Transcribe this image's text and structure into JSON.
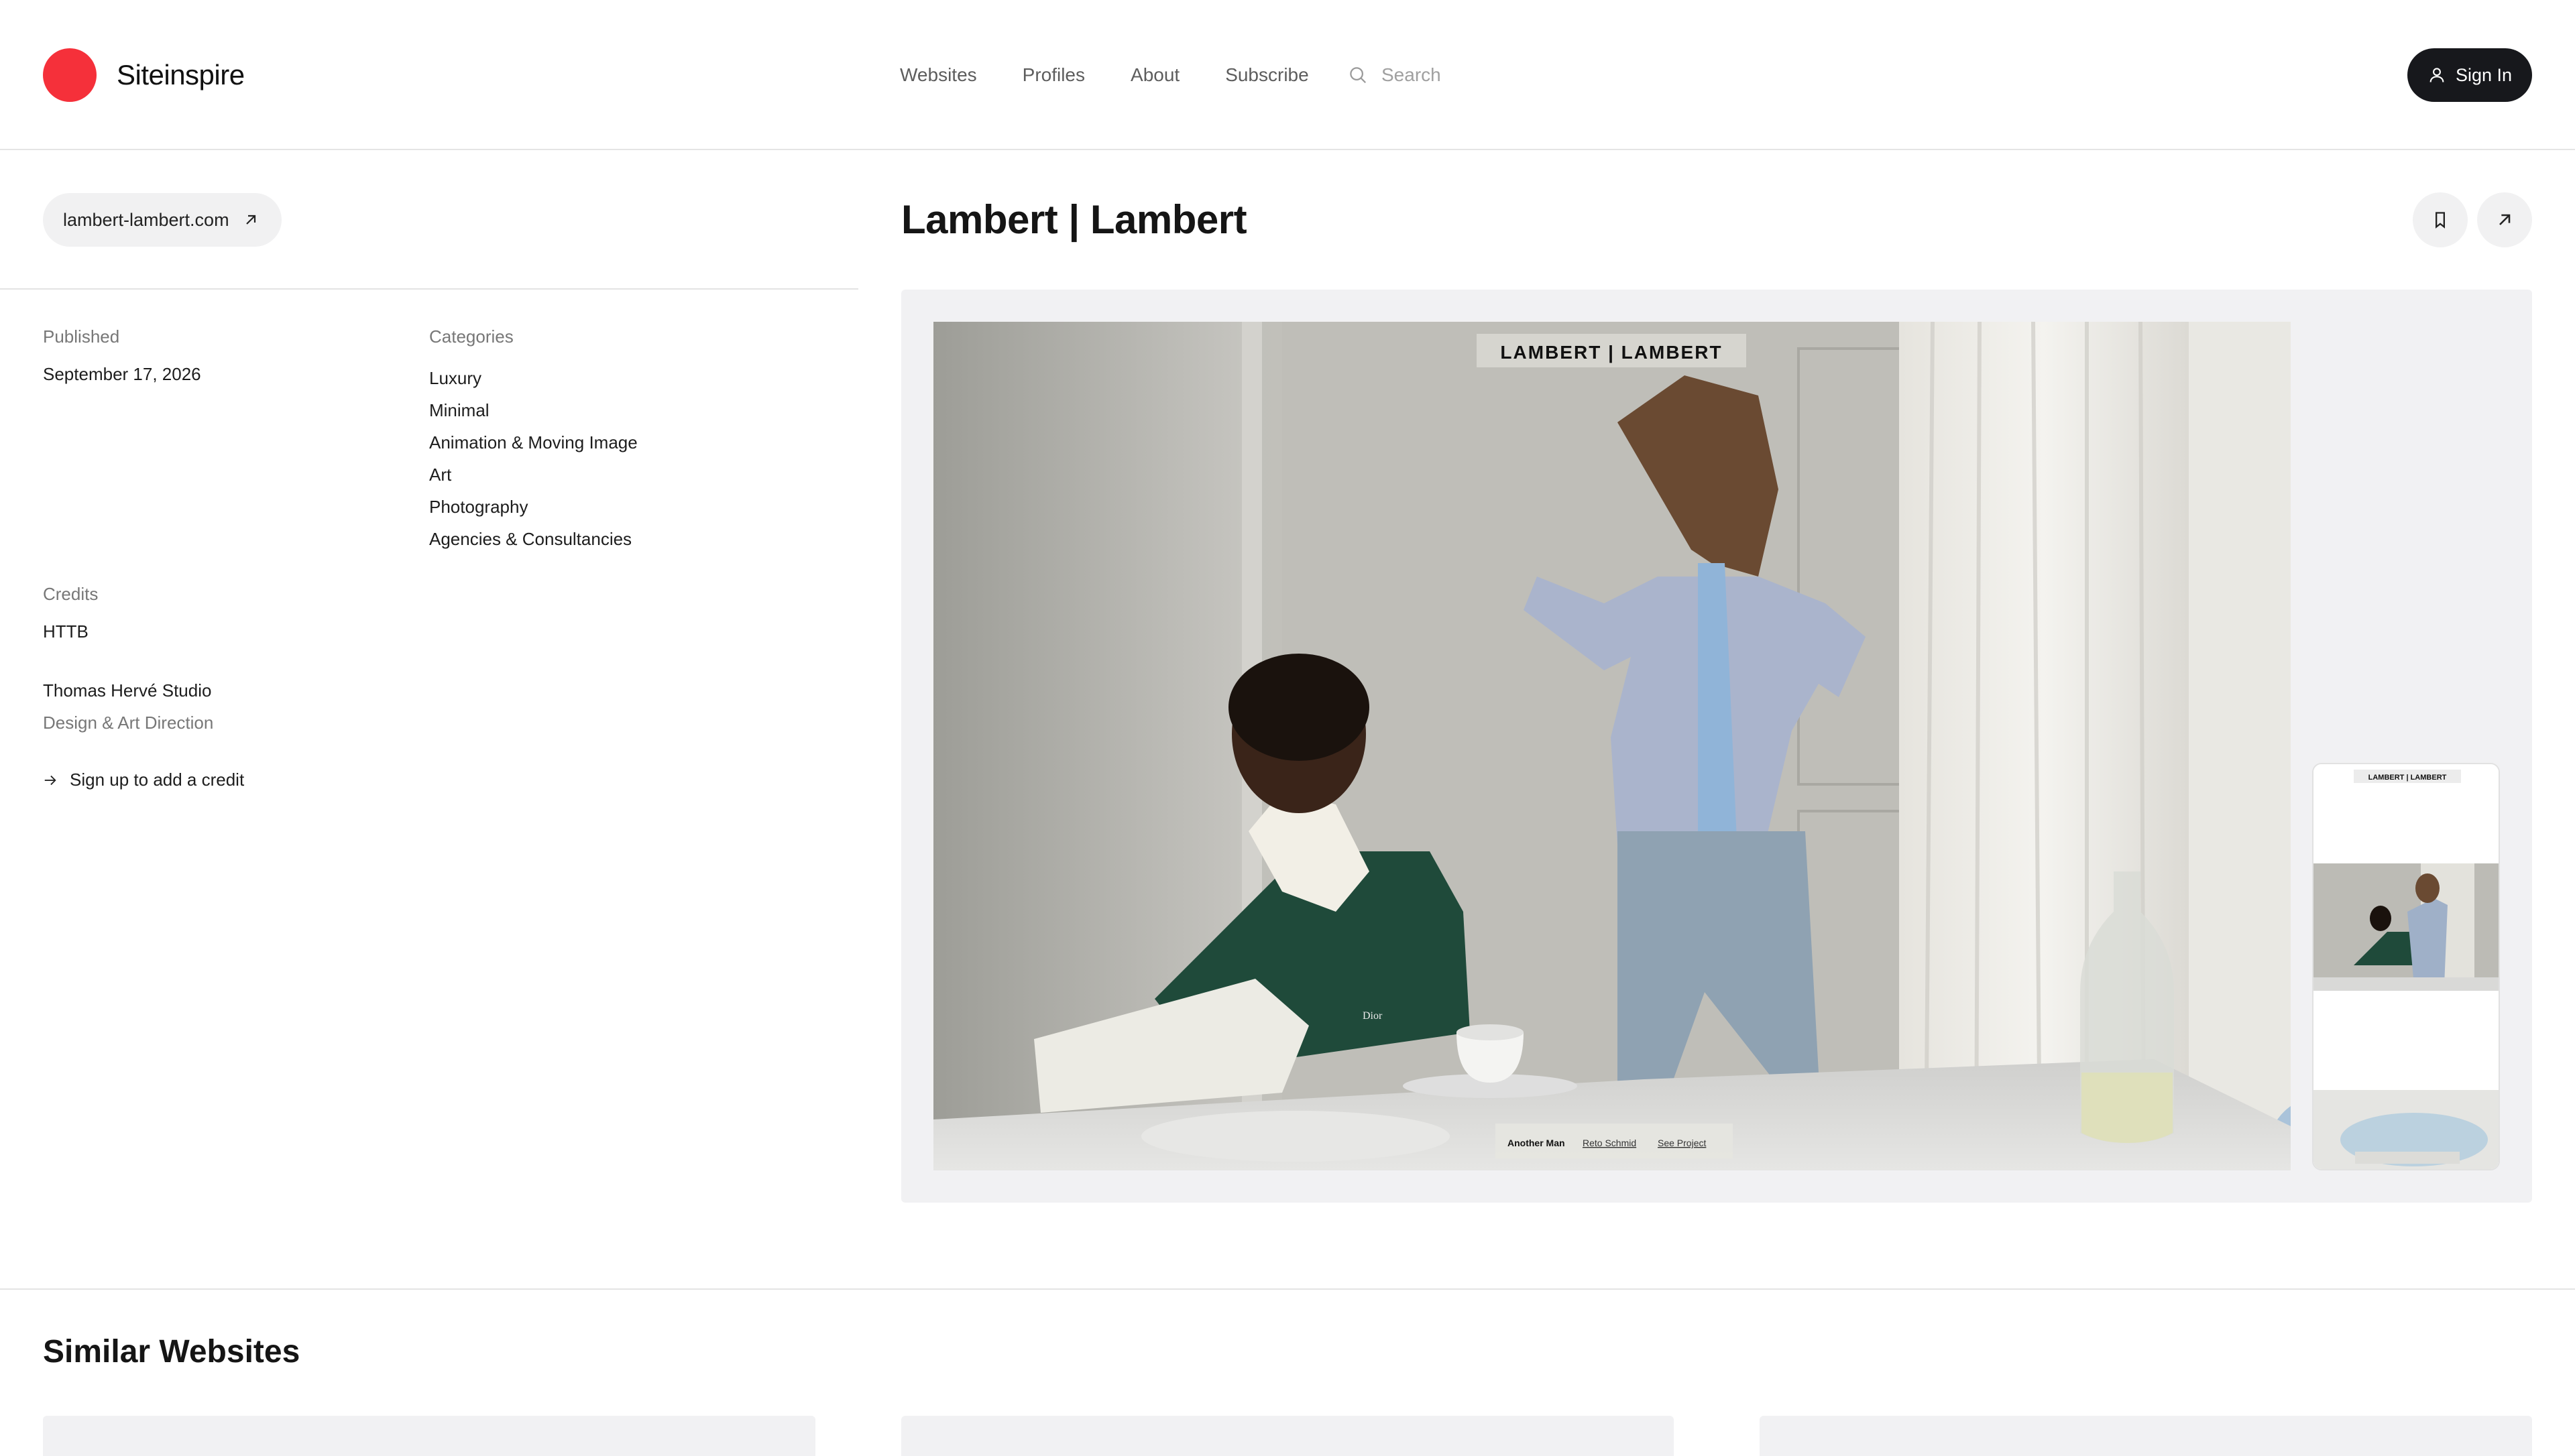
{
  "brand": {
    "name": "Siteinspire",
    "logo_color": "#f5303a"
  },
  "nav": {
    "items": [
      "Websites",
      "Profiles",
      "About",
      "Subscribe"
    ]
  },
  "search": {
    "placeholder": "Search",
    "icon": "search-icon"
  },
  "auth": {
    "sign_in_label": "Sign In",
    "icon": "user-icon"
  },
  "site": {
    "url": "lambert-lambert.com",
    "title": "Lambert | Lambert",
    "published_label": "Published",
    "published_date": "September 17, 2026",
    "categories_label": "Categories",
    "categories": [
      "Luxury",
      "Minimal",
      "Animation & Moving Image",
      "Art",
      "Photography",
      "Agencies & Consultancies"
    ],
    "credits_label": "Credits",
    "credits": [
      {
        "name": "HTTB",
        "role": ""
      },
      {
        "name": "Thomas Hervé Studio",
        "role": "Design & Art Direction"
      }
    ],
    "add_credit_label": "Sign up to add a credit"
  },
  "preview": {
    "site_logo": "LAMBERT | LAMBERT",
    "caption_title": "Another Man",
    "caption_link_1": "Reto Schmid",
    "caption_link_2": "See Project",
    "sweater_brand": "Dior"
  },
  "similar": {
    "heading": "Similar Websites"
  }
}
